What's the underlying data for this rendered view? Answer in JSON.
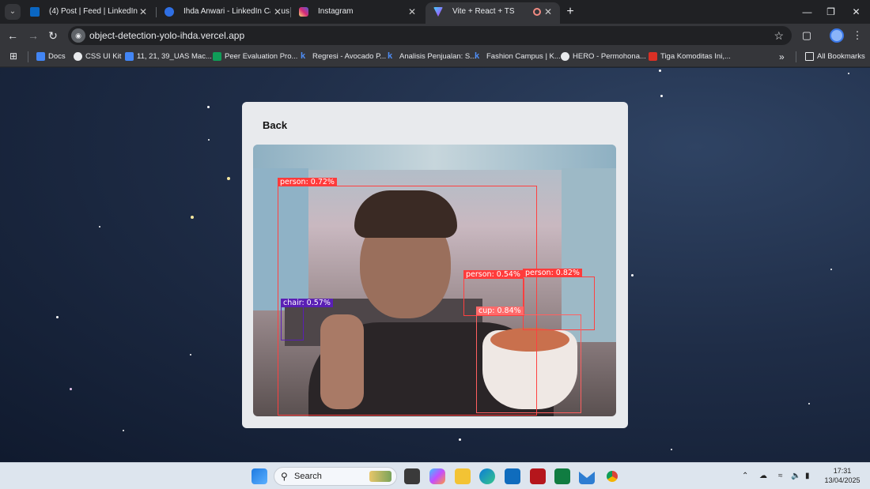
{
  "browser": {
    "tabs": [
      {
        "title": "(4) Post | Feed | LinkedIn",
        "icon": "linkedin-icon",
        "color": "#0a66c2"
      },
      {
        "title": "Ihda Anwari - LinkedIn Carousel",
        "icon": "carousel-icon",
        "color": "#2f6fe4"
      },
      {
        "title": "Instagram",
        "icon": "instagram-icon",
        "color": "#d62976"
      },
      {
        "title": "Vite + React + TS",
        "icon": "vite-icon",
        "color": "#9d5cff"
      }
    ],
    "url": "object-detection-yolo-ihda.vercel.app",
    "bookmarks": [
      {
        "label": "Docs",
        "color": "#4285f4"
      },
      {
        "label": "CSS UI Kit",
        "color": "#e8eaed"
      },
      {
        "label": "11, 21, 39_UAS Mac...",
        "color": "#4285f4"
      },
      {
        "label": "Peer Evaluation Pro...",
        "color": "#0f9d58"
      },
      {
        "label": "Regresi - Avocado P...",
        "color": "#1a73e8"
      },
      {
        "label": "Analisis Penjualan: S...",
        "color": "#1a73e8"
      },
      {
        "label": "Fashion Campus | K...",
        "color": "#1a73e8"
      },
      {
        "label": "HERO - Permohona...",
        "color": "#e8eaed"
      },
      {
        "label": "Tiga Komoditas Ini,...",
        "color": "#d93025"
      }
    ],
    "all_bookmarks": "All Bookmarks"
  },
  "app": {
    "back_label": "Back",
    "detections": [
      {
        "label": "person: 0.72%"
      },
      {
        "label": "person: 0.54%"
      },
      {
        "label": "person: 0.82%"
      },
      {
        "label": "cup: 0.84%"
      },
      {
        "label": "chair: 0.57%"
      }
    ]
  },
  "taskbar": {
    "search_placeholder": "Search",
    "time": "17:31",
    "date": "13/04/2025"
  }
}
